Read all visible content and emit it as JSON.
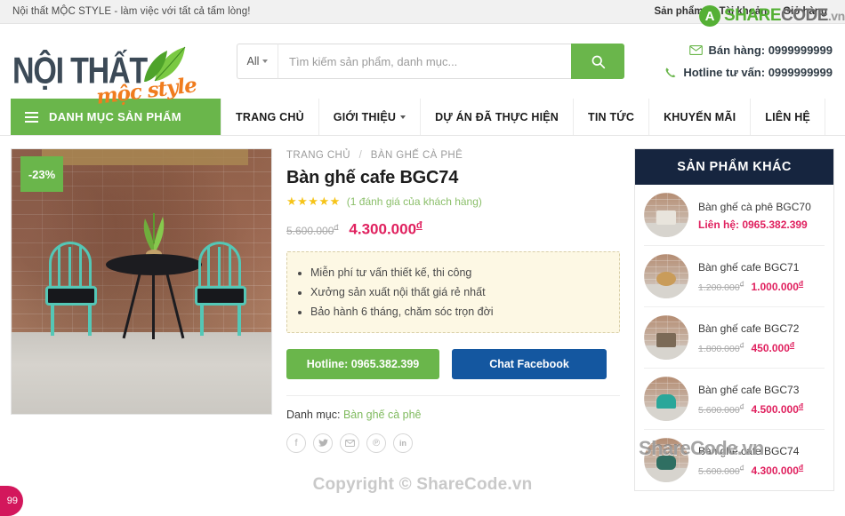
{
  "topbar": {
    "slogan": "Nội thất MỘC STYLE - làm việc với tất cả tấm lòng!",
    "links": [
      "Sản phẩm",
      "Tài khoản",
      "Giỏ hàng"
    ]
  },
  "header": {
    "logo_main": "NỘI THẤT",
    "logo_script": "mộc style",
    "search": {
      "scope": "All",
      "placeholder": "Tìm kiếm sản phẩm, danh mục...",
      "value": "",
      "button_icon": "search-icon"
    },
    "contacts": [
      {
        "icon": "mail-icon",
        "label": "Bán hàng: 0999999999"
      },
      {
        "icon": "phone-icon",
        "label": "Hotline tư vấn: 0999999999"
      }
    ]
  },
  "nav": {
    "category_button": "DANH MỤC SẢN PHẨM",
    "items": [
      {
        "label": "TRANG CHỦ",
        "caret": false
      },
      {
        "label": "GIỚI THIỆU",
        "caret": true
      },
      {
        "label": "DỰ ÁN ĐÃ THỰC HIỆN",
        "caret": false
      },
      {
        "label": "TIN TỨC",
        "caret": false
      },
      {
        "label": "KHUYẾN MÃI",
        "caret": false
      },
      {
        "label": "LIÊN HỆ",
        "caret": false
      }
    ]
  },
  "product": {
    "sale_badge": "-23%",
    "breadcrumb": {
      "home": "TRANG CHỦ",
      "separator": "/",
      "current": "BÀN GHẾ CÀ PHÊ"
    },
    "title": "Bàn ghế cafe BGC74",
    "stars": "★★★★★",
    "rating_text": "(1 đánh giá của khách hàng)",
    "old_price": "5.600.000",
    "old_price_unit": "đ",
    "new_price": "4.300.000",
    "new_price_unit": "đ",
    "features": [
      "Miễn phí tư vấn thiết kế, thi công",
      "Xưởng sản xuất nội thất giá rẻ nhất",
      "Bảo hành 6 tháng, chăm sóc trọn đời"
    ],
    "hotline_button": "Hotline: 0965.382.399",
    "facebook_button": "Chat Facebook",
    "category_label": "Danh mục:",
    "category_value": "Bàn ghế cà phê",
    "share_icons": [
      "facebook-icon",
      "twitter-icon",
      "email-icon",
      "pinterest-icon",
      "linkedin-icon"
    ]
  },
  "aside": {
    "title": "SẢN PHẨM KHÁC",
    "items": [
      {
        "name": "Bàn ghế cà phê BGC70",
        "contact": "Liên hệ: 0965.382.399",
        "old": "",
        "new": "",
        "unit": ""
      },
      {
        "name": "Bàn ghế cafe BGC71",
        "contact": "",
        "old": "1.200.000",
        "new": "1.000.000",
        "unit": "đ"
      },
      {
        "name": "Bàn ghế cafe BGC72",
        "contact": "",
        "old": "1.800.000",
        "new": "450.000",
        "unit": "đ"
      },
      {
        "name": "Bàn ghế cafe BGC73",
        "contact": "",
        "old": "5.600.000",
        "new": "4.500.000",
        "unit": "đ"
      },
      {
        "name": "Bàn ghế cafe BGC74",
        "contact": "",
        "old": "5.600.000",
        "new": "4.300.000",
        "unit": "đ"
      }
    ]
  },
  "footer": {
    "copyright": "Copyright © ShareCode.vn",
    "corner_badge": "99"
  },
  "watermark": {
    "logo_letter": "A",
    "text_green": "SHARE",
    "text_grey": "CODE",
    "text_suffix": ".vn",
    "overlay_text": "ShareCode.vn"
  },
  "colors": {
    "green": "#6ab64b",
    "navy": "#16253f",
    "pink": "#e0215f",
    "facebook_blue": "#1457a0"
  }
}
